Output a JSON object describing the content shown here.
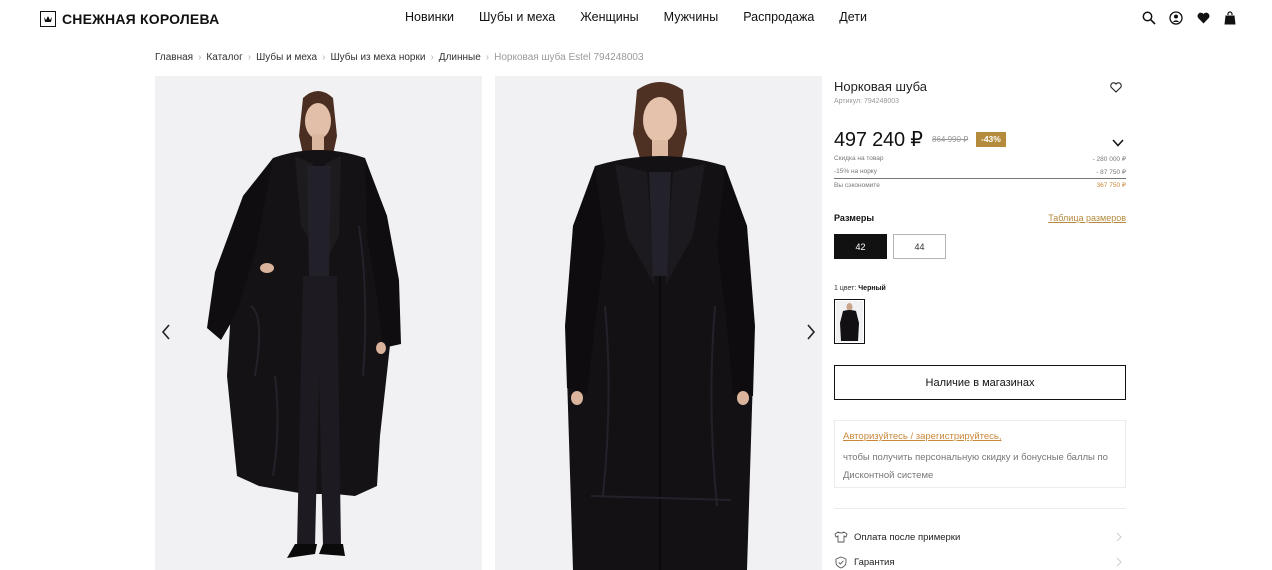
{
  "brand": {
    "name": "СНЕЖНАЯ КОРОЛЕВА"
  },
  "nav": [
    "Новинки",
    "Шубы и меха",
    "Женщины",
    "Мужчины",
    "Распродажа",
    "Дети"
  ],
  "breadcrumb": [
    "Главная",
    "Каталог",
    "Шубы и меха",
    "Шубы из меха норки",
    "Длинные",
    "Норковая шуба Estel 794248003"
  ],
  "product": {
    "title": "Норковая шуба",
    "article": "Артикул: 794248003",
    "price": "497 240 ₽",
    "old_price": "864 990 ₽",
    "discount": "-43%",
    "breakdown": [
      {
        "label": "Скидка на товар",
        "value": "- 280 000 ₽"
      },
      {
        "label": "-15% на норку",
        "value": "- 87 750 ₽"
      },
      {
        "label": "Вы сэкономите",
        "value": "367 750 ₽"
      }
    ],
    "sizes_label": "Размеры",
    "size_table_link": "Таблица размеров",
    "sizes": [
      "42",
      "44"
    ],
    "selected_size": "42",
    "color_count_label": "1 цвет:",
    "color_name": "Черный",
    "availability_button": "Наличие в магазинах",
    "auth_link": "Авторизуйтесь / зарегистрируйтесь,",
    "auth_text": "чтобы получить персональную скидку и бонусные баллы по Дисконтной системе",
    "features": [
      "Оплата после примерки",
      "Гарантия"
    ]
  },
  "colors": {
    "accent": "#b48a3c",
    "savings": "#c9873a",
    "coat": "#111111",
    "background": "#f1f1f3"
  },
  "icons": [
    "logo-mark-icon",
    "search-icon",
    "user-icon",
    "heart-icon",
    "bag-icon",
    "chevron-left-icon",
    "chevron-right-icon",
    "chevron-down-icon",
    "tshirt-icon",
    "shield-icon"
  ]
}
